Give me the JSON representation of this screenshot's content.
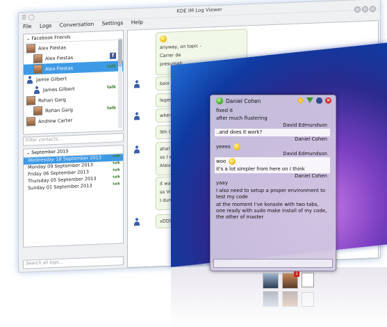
{
  "logviewer": {
    "title": "KDE IM Log Viewer",
    "menu": [
      "File",
      "Logs",
      "Conversation",
      "Settings",
      "Help"
    ],
    "group_title": "Facebook Friends",
    "contacts": [
      {
        "name": "Alex Fiestas",
        "level": 0,
        "kind": "avatar"
      },
      {
        "name": "Alex Fiestas",
        "level": 1,
        "kind": "avatar",
        "proto": "fb"
      },
      {
        "name": "Alex Fiestas",
        "level": 1,
        "kind": "avatar",
        "proto": "talk",
        "selected": true
      },
      {
        "name": "Jamie Gilbert",
        "level": 0,
        "kind": "person"
      },
      {
        "name": "James Gilbert",
        "level": 1,
        "kind": "person",
        "proto": "talk"
      },
      {
        "name": "Rohan Garg",
        "level": 0,
        "kind": "avatar"
      },
      {
        "name": "Rohan Garg",
        "level": 1,
        "kind": "avatar",
        "proto": "talk"
      },
      {
        "name": "Andrew Carter",
        "level": 0,
        "kind": "avatar"
      }
    ],
    "filter_placeholder": "Filter contacts...",
    "month_header": "September 2013",
    "dates": [
      {
        "label": "Wednesday 18 September 2013",
        "selected": true
      },
      {
        "label": "Monday 09 September 2013"
      },
      {
        "label": "Friday 06 September 2013"
      },
      {
        "label": "Thursday 05 September 2013"
      },
      {
        "label": "Sunday 01 September 2013"
      }
    ],
    "search_placeholder": "Search all logs...",
    "messages": [
      "anyway, on topic - ",
      "Carrer de",
      "presumab",
      "baix 1",
      "legend, th",
      "when are",
      "9th Oct",
      "aha!",
      "so I was n",
      "Alaix was",
      "it was go",
      "so Vishes",
      "I dunno w",
      "xDDD"
    ]
  },
  "chat": {
    "contact": "Daniel Cohen",
    "lines": [
      {
        "text": "fixed it",
        "hl": false
      },
      {
        "text": "after much flustering",
        "hl": false
      },
      {
        "sender": "David Edmundson"
      },
      {
        "text": "..and does it work?",
        "hl": true
      },
      {
        "sender": "Daniel Cohen"
      },
      {
        "text": "yeees",
        "hl": false,
        "smiley": true
      },
      {
        "sender": "David Edmundson"
      },
      {
        "text": "woo",
        "hl": true,
        "smiley": true
      },
      {
        "text": "it's a lot simpler from here on I think",
        "hl": true
      },
      {
        "sender": "Daniel Cohen"
      },
      {
        "text": "yaay",
        "hl": false
      },
      {
        "text": "I also need to setup a proper environment to test my code",
        "hl": false
      },
      {
        "text": "at the moment I've konsole with two tabs, one ready with sudo make install of my code, the other of master",
        "hl": false
      }
    ]
  },
  "taskbar": {
    "badge": "1"
  }
}
